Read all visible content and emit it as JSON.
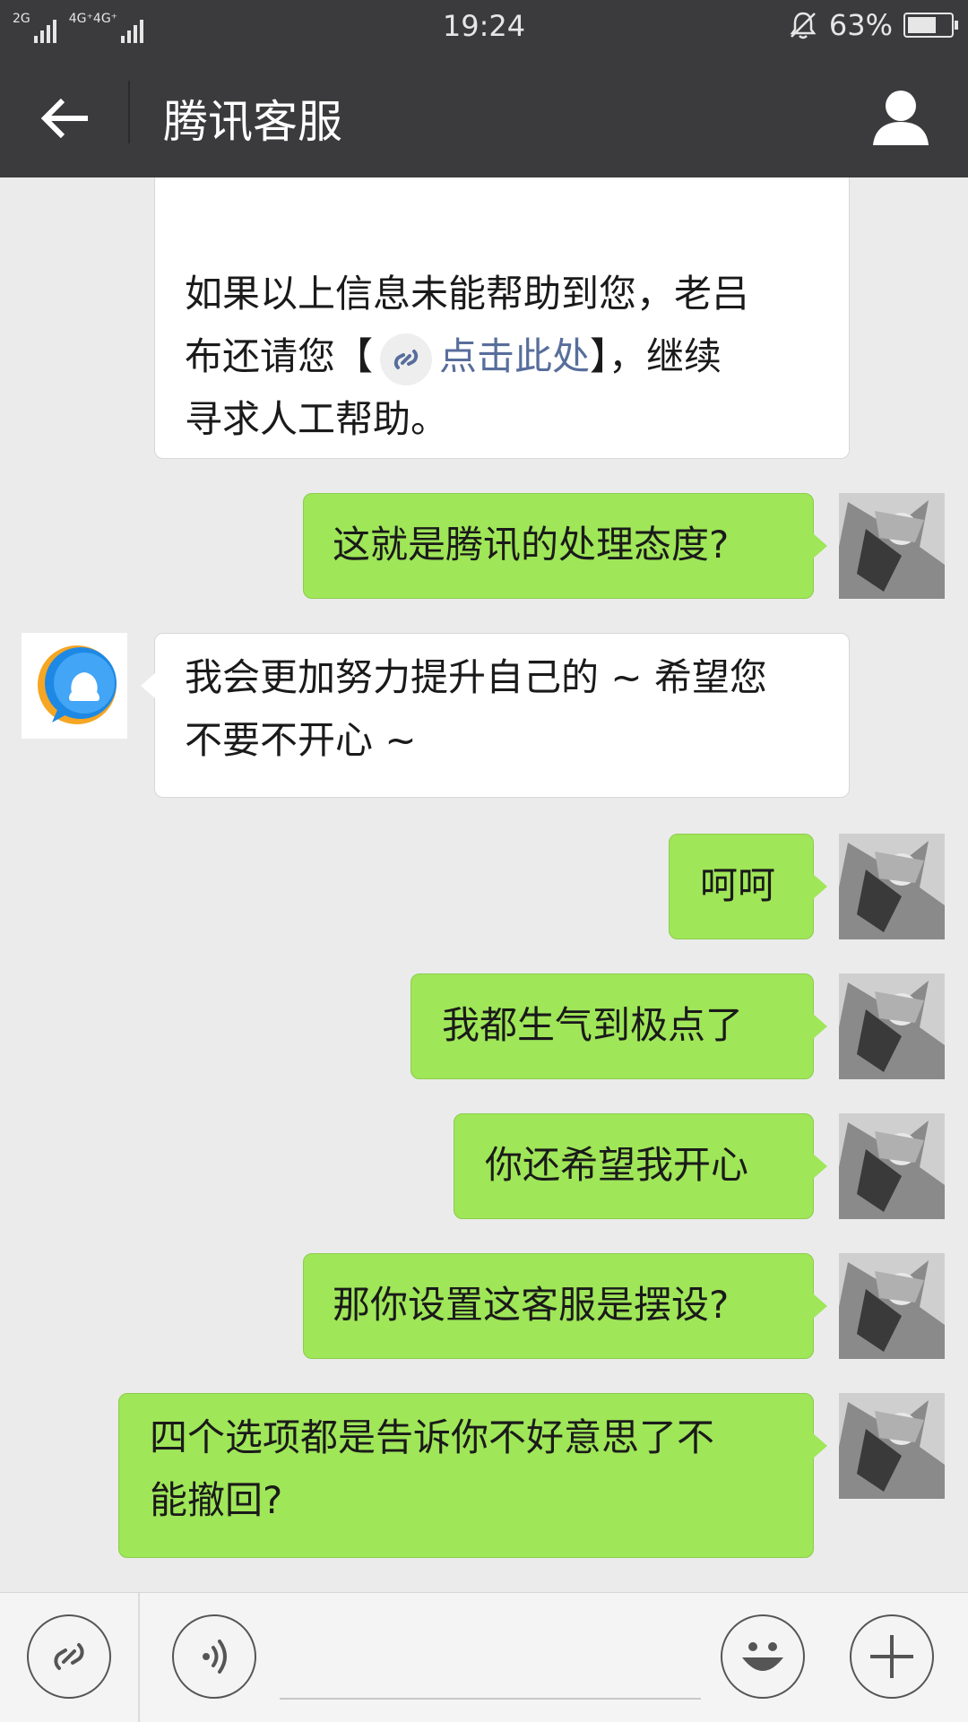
{
  "status_bar": {
    "sim1_label": "2G",
    "sim2_label": "4G⁺4G⁺",
    "time": "19:24",
    "battery_percent": "63%",
    "battery_level": 0.63
  },
  "header": {
    "title": "腾讯客服"
  },
  "messages": [
    {
      "sender": "agent",
      "lines": [
        "如果以上信息未能帮助到您，老吕",
        "还请您【",
        "点击此处",
        "】，继续",
        "寻求人工帮助。"
      ],
      "line2_prefix": "布还请您【",
      "link_text": "点击此处",
      "line2_suffix": "】，继续"
    },
    {
      "sender": "user",
      "text": "这就是腾讯的处理态度?"
    },
    {
      "sender": "agent",
      "line1": "我会更加努力提升自己的 ~ 希望您",
      "line2": "不要不开心 ~"
    },
    {
      "sender": "user",
      "text": "呵呵"
    },
    {
      "sender": "user",
      "text": "我都生气到极点了"
    },
    {
      "sender": "user",
      "text": "你还希望我开心"
    },
    {
      "sender": "user",
      "text": "那你设置这客服是摆设?"
    },
    {
      "sender": "user",
      "line1": "四个选项都是告诉你不好意思了不",
      "line2": "能撤回?"
    }
  ],
  "first_message": {
    "line1": "如果以上信息未能帮助到您，老吕",
    "line2_prefix": "布还请您【",
    "link_text": "点击此处",
    "line2_suffix": "】，继续",
    "line3": "寻求人工帮助。"
  },
  "colors": {
    "header_bg": "#3b3b3d",
    "chat_bg": "#ebebeb",
    "user_bubble": "#9fe658",
    "agent_bubble": "#ffffff",
    "link": "#586e9c"
  },
  "icons": [
    "back-arrow-icon",
    "profile-icon",
    "link-icon",
    "voice-icon",
    "emoji-icon",
    "plus-icon",
    "qq-logo-icon"
  ]
}
